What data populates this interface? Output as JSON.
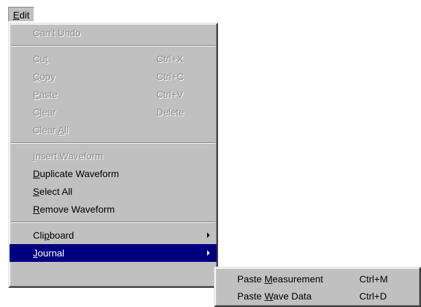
{
  "menubar": {
    "edit": {
      "label_first": "E",
      "label_rest": "dit"
    }
  },
  "menu": {
    "items": [
      {
        "pre": "",
        "ul": "",
        "post": "Can't Undo",
        "shortcut": "",
        "disabled": true
      },
      {
        "pre": "Cu",
        "ul": "t",
        "post": "",
        "shortcut": "Ctrl+X",
        "disabled": true
      },
      {
        "pre": "",
        "ul": "C",
        "post": "opy",
        "shortcut": "Ctrl+C",
        "disabled": true
      },
      {
        "pre": "",
        "ul": "P",
        "post": "aste",
        "shortcut": "Ctrl+V",
        "disabled": true
      },
      {
        "pre": "C",
        "ul": "l",
        "post": "ear",
        "shortcut": "Delete",
        "disabled": true
      },
      {
        "pre": "Clear ",
        "ul": "A",
        "post": "ll",
        "shortcut": "",
        "disabled": true
      },
      {
        "pre": "",
        "ul": "I",
        "post": "nsert Waveform",
        "shortcut": "",
        "disabled": true
      },
      {
        "pre": "",
        "ul": "D",
        "post": "uplicate Waveform",
        "shortcut": "",
        "disabled": false
      },
      {
        "pre": "",
        "ul": "S",
        "post": "elect All",
        "shortcut": "",
        "disabled": false
      },
      {
        "pre": "",
        "ul": "R",
        "post": "emove Waveform",
        "shortcut": "",
        "disabled": false
      },
      {
        "pre": "Cli",
        "ul": "p",
        "post": "board",
        "shortcut": "",
        "disabled": false,
        "submenu": true
      },
      {
        "pre": "",
        "ul": "J",
        "post": "ournal",
        "shortcut": "",
        "disabled": false,
        "submenu": true,
        "selected": true
      }
    ]
  },
  "submenu": {
    "items": [
      {
        "pre": "Paste ",
        "ul": "M",
        "post": "easurement",
        "shortcut": "Ctrl+M"
      },
      {
        "pre": "Paste ",
        "ul": "W",
        "post": "ave Data",
        "shortcut": "Ctrl+D"
      }
    ]
  },
  "colors": {
    "menu_bg": "#c0c0c0",
    "selection": "#000080",
    "disabled_text": "#8c8c8c"
  }
}
